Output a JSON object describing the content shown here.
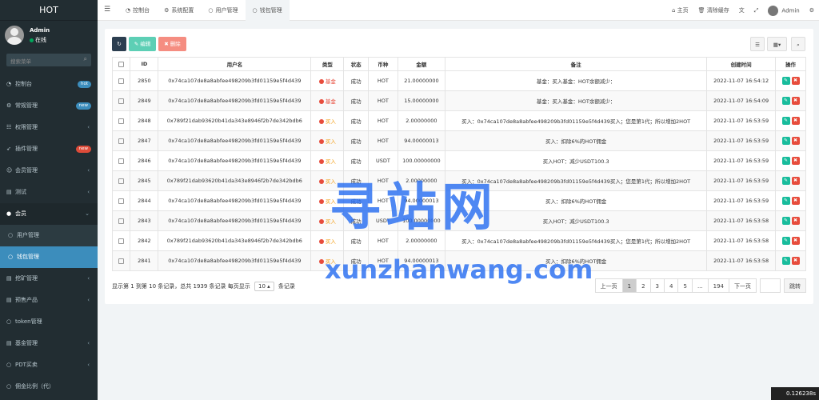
{
  "app": {
    "logo": "HOT"
  },
  "user": {
    "name": "Admin",
    "status": "在线"
  },
  "search": {
    "placeholder": "搜索菜单"
  },
  "sidebar": {
    "items": [
      {
        "label": "控制台",
        "icon": "dashboard-icon",
        "badge": "hot",
        "badge_color": "#3c8dbc"
      },
      {
        "label": "常规管理",
        "icon": "cogs-icon",
        "badge": "new",
        "badge_color": "#3c8dbc"
      },
      {
        "label": "权限管理",
        "icon": "group-icon",
        "chevron": "‹"
      },
      {
        "label": "插件管理",
        "icon": "rocket-icon",
        "badge": "new",
        "badge_color": "#dd4b39"
      },
      {
        "label": "会员管理",
        "icon": "user-icon",
        "chevron": "‹"
      },
      {
        "label": "测试",
        "icon": "file-icon",
        "chevron": "‹"
      },
      {
        "label": "会员",
        "icon": "user-circle-icon",
        "chevron": "⌄"
      }
    ],
    "sub_items": [
      {
        "label": "用户管理"
      },
      {
        "label": "钱包管理"
      }
    ],
    "more_items": [
      {
        "label": "挖矿管理",
        "chevron": "‹"
      },
      {
        "label": "预售产品",
        "chevron": "‹"
      },
      {
        "label": "token管理"
      },
      {
        "label": "基金管理",
        "chevron": "‹"
      },
      {
        "label": "PDT买卖",
        "chevron": "‹"
      },
      {
        "label": "佣金比例（代）"
      }
    ]
  },
  "topbar": {
    "tabs": [
      {
        "label": "控制台",
        "icon": "dashboard-icon"
      },
      {
        "label": "系统配置",
        "icon": "gear-icon"
      },
      {
        "label": "用户管理",
        "icon": "circle-icon"
      },
      {
        "label": "钱包管理",
        "icon": "circle-icon"
      }
    ],
    "home": "主页",
    "clear_cache": "清除缓存",
    "admin": "Admin"
  },
  "toolbar": {
    "edit": "编辑",
    "delete": "删除"
  },
  "table": {
    "headers": [
      "ID",
      "用户名",
      "类型",
      "状态",
      "币种",
      "金额",
      "备注",
      "创建时间",
      "操作"
    ],
    "rows": [
      {
        "id": "2850",
        "username": "0x74ca107de8a8abfee498209b3fd01159e5f4d439",
        "type": "基金",
        "status": "成功",
        "coin": "HOT",
        "amount": "21.00000000",
        "remark": "基金：买入基金：HOT余额减少：",
        "time": "2022-11-07 16:54:12"
      },
      {
        "id": "2849",
        "username": "0x74ca107de8a8abfee498209b3fd01159e5f4d439",
        "type": "基金",
        "status": "成功",
        "coin": "HOT",
        "amount": "15.00000000",
        "remark": "基金：买入基金：HOT余额减少：",
        "time": "2022-11-07 16:54:09"
      },
      {
        "id": "2848",
        "username": "0x789f21dab93620b41da343e8946f2b7de342bdb6",
        "type": "买入",
        "status": "成功",
        "coin": "HOT",
        "amount": "2.00000000",
        "remark": "买入：0x74ca107de8a8abfee498209b3fd01159e5f4d439买入；您是第1代；所以增加2HOT",
        "time": "2022-11-07 16:53:59"
      },
      {
        "id": "2847",
        "username": "0x74ca107de8a8abfee498209b3fd01159e5f4d439",
        "type": "买入",
        "status": "成功",
        "coin": "HOT",
        "amount": "94.00000013",
        "remark": "买入：扣除6%的HOT佣金",
        "time": "2022-11-07 16:53:59"
      },
      {
        "id": "2846",
        "username": "0x74ca107de8a8abfee498209b3fd01159e5f4d439",
        "type": "买入",
        "status": "成功",
        "coin": "USDT",
        "amount": "100.00000000",
        "remark": "买入HOT：减少USDT100.3",
        "time": "2022-11-07 16:53:59"
      },
      {
        "id": "2845",
        "username": "0x789f21dab93620b41da343e8946f2b7de342bdb6",
        "type": "买入",
        "status": "成功",
        "coin": "HOT",
        "amount": "2.00000000",
        "remark": "买入：0x74ca107de8a8abfee498209b3fd01159e5f4d439买入；您是第1代；所以增加2HOT",
        "time": "2022-11-07 16:53:59"
      },
      {
        "id": "2844",
        "username": "0x74ca107de8a8abfee498209b3fd01159e5f4d439",
        "type": "买入",
        "status": "成功",
        "coin": "HOT",
        "amount": "94.00000013",
        "remark": "买入：扣除6%的HOT佣金",
        "time": "2022-11-07 16:53:59"
      },
      {
        "id": "2843",
        "username": "0x74ca107de8a8abfee498209b3fd01159e5f4d439",
        "type": "买入",
        "status": "成功",
        "coin": "USDT",
        "amount": "100.00000000",
        "remark": "买入HOT：减少USDT100.3",
        "time": "2022-11-07 16:53:58"
      },
      {
        "id": "2842",
        "username": "0x789f21dab93620b41da343e8946f2b7de342bdb6",
        "type": "买入",
        "status": "成功",
        "coin": "HOT",
        "amount": "2.00000000",
        "remark": "买入：0x74ca107de8a8abfee498209b3fd01159e5f4d439买入；您是第1代；所以增加2HOT",
        "time": "2022-11-07 16:53:58"
      },
      {
        "id": "2841",
        "username": "0x74ca107de8a8abfee498209b3fd01159e5f4d439",
        "type": "买入",
        "status": "成功",
        "coin": "HOT",
        "amount": "94.00000013",
        "remark": "买入：扣除6%的HOT佣金",
        "time": "2022-11-07 16:53:58"
      }
    ]
  },
  "pagination": {
    "summary_prefix": "显示第 1 到第 10 条记录，总共 1939 条记录 每页显示",
    "page_size": "10",
    "summary_suffix": "条记录",
    "prev": "上一页",
    "pages": [
      "1",
      "2",
      "3",
      "4",
      "5",
      "...",
      "194"
    ],
    "next": "下一页",
    "jump": "跳转"
  },
  "watermark": {
    "cn": "寻站网",
    "en": "xunzhanwang.com"
  },
  "timer": "0.126238s",
  "colors": {
    "sidebar": "#222d32",
    "active": "#3c8dbc",
    "danger": "#e74c3c",
    "success": "#18bc9c"
  }
}
